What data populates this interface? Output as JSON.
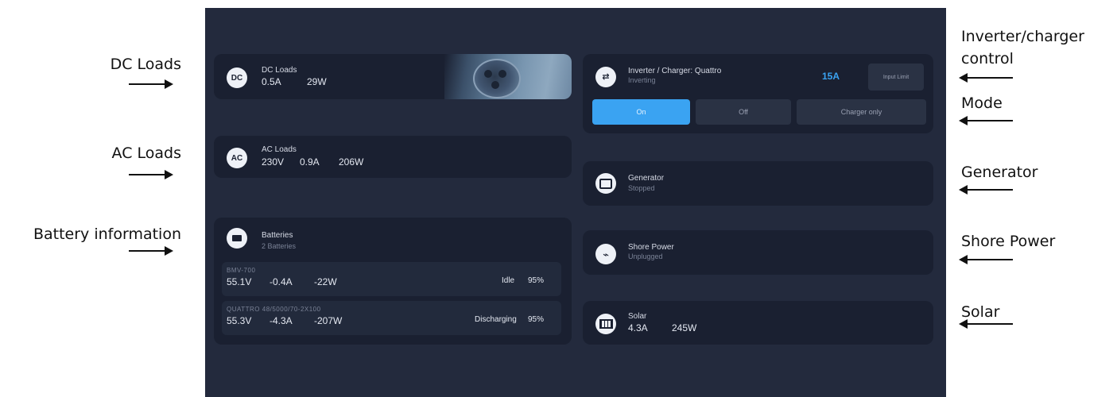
{
  "annotations": {
    "dc_loads": "DC Loads",
    "ac_loads": "AC Loads",
    "battery_information": "Battery information",
    "inverter_line1": "Inverter/charger",
    "inverter_line2": "control",
    "mode": "Mode",
    "generator": "Generator",
    "shore_power": "Shore Power",
    "solar": "Solar"
  },
  "dc_loads": {
    "icon": "DC",
    "title": "DC Loads",
    "current": "0.5A",
    "power": "29W"
  },
  "ac_loads": {
    "icon": "AC",
    "title": "AC Loads",
    "voltage": "230V",
    "current": "0.9A",
    "power": "206W"
  },
  "batteries": {
    "icon": "battery-icon",
    "title": "Batteries",
    "subtitle": "2 Batteries",
    "items": [
      {
        "name": "BMV-700",
        "voltage": "55.1V",
        "current": "-0.4A",
        "power": "-22W",
        "state": "Idle",
        "soc": "95%"
      },
      {
        "name": "QUATTRO 48/5000/70-2X100",
        "voltage": "55.3V",
        "current": "-4.3A",
        "power": "-207W",
        "state": "Discharging",
        "soc": "95%"
      }
    ]
  },
  "inverter": {
    "icon": "inverter-icon",
    "title": "Inverter / Charger: Quattro",
    "status": "Inverting",
    "input_limit": "15A",
    "input_limit_button": "Input Limit",
    "modes": [
      "On",
      "Off",
      "Charger only"
    ],
    "active_mode": "On",
    "accent_color": "#3aa3f2"
  },
  "generator": {
    "icon": "generator-icon",
    "title": "Generator",
    "status": "Stopped"
  },
  "shore_power": {
    "icon": "plug-icon",
    "title": "Shore Power",
    "status": "Unplugged"
  },
  "solar": {
    "icon": "solar-panel-icon",
    "title": "Solar",
    "current": "4.3A",
    "power": "245W"
  }
}
